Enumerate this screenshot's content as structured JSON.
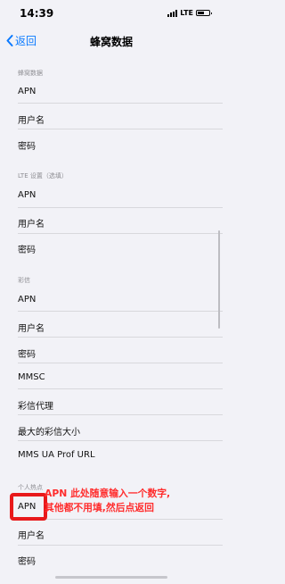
{
  "status": {
    "time": "14:39",
    "network": "LTE"
  },
  "nav": {
    "back_label": "返回",
    "title": "蜂窝数据"
  },
  "sections": {
    "cellular_data": {
      "header": "蜂窝数据",
      "apn": "APN",
      "username": "用户名",
      "password": "密码"
    },
    "lte": {
      "header": "LTE 设置（选填）",
      "apn": "APN",
      "username": "用户名",
      "password": "密码"
    },
    "mms": {
      "header": "彩信",
      "apn": "APN",
      "username": "用户名",
      "password": "密码",
      "mmsc": "MMSC",
      "mms_proxy": "彩信代理",
      "max_size": "最大的彩信大小",
      "ua_prof_url": "MMS UA Prof URL"
    },
    "hotspot": {
      "header": "个人热点",
      "apn": "APN",
      "username": "用户名",
      "password": "密码"
    }
  },
  "annotation": {
    "line1": "APN 此处随意输入一个数字,",
    "line2": "其他都不用填,然后点返回"
  },
  "colors": {
    "accent": "#0a7aff",
    "annotation": "#ff2c2c",
    "background": "#f2f2f7"
  }
}
